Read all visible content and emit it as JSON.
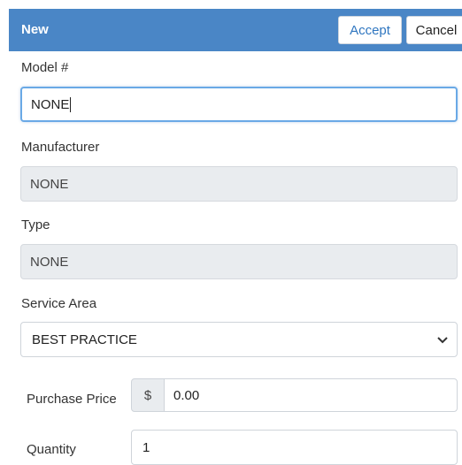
{
  "header": {
    "title": "New",
    "accept_label": "Accept",
    "cancel_label": "Cancel"
  },
  "form": {
    "model": {
      "label": "Model #",
      "value": "NONE"
    },
    "manufacturer": {
      "label": "Manufacturer",
      "value": "NONE"
    },
    "type": {
      "label": "Type",
      "value": "NONE"
    },
    "service_area": {
      "label": "Service Area",
      "value": "BEST PRACTICE",
      "icon": "chevron-down-icon"
    },
    "purchase_price": {
      "label": "Purchase Price",
      "currency": "$",
      "value": "0.00"
    },
    "quantity": {
      "label": "Quantity",
      "value": "1"
    }
  },
  "colors": {
    "header_bg": "#4a86c6",
    "accent": "#2f76c0",
    "readonly_bg": "#e9ecef"
  }
}
